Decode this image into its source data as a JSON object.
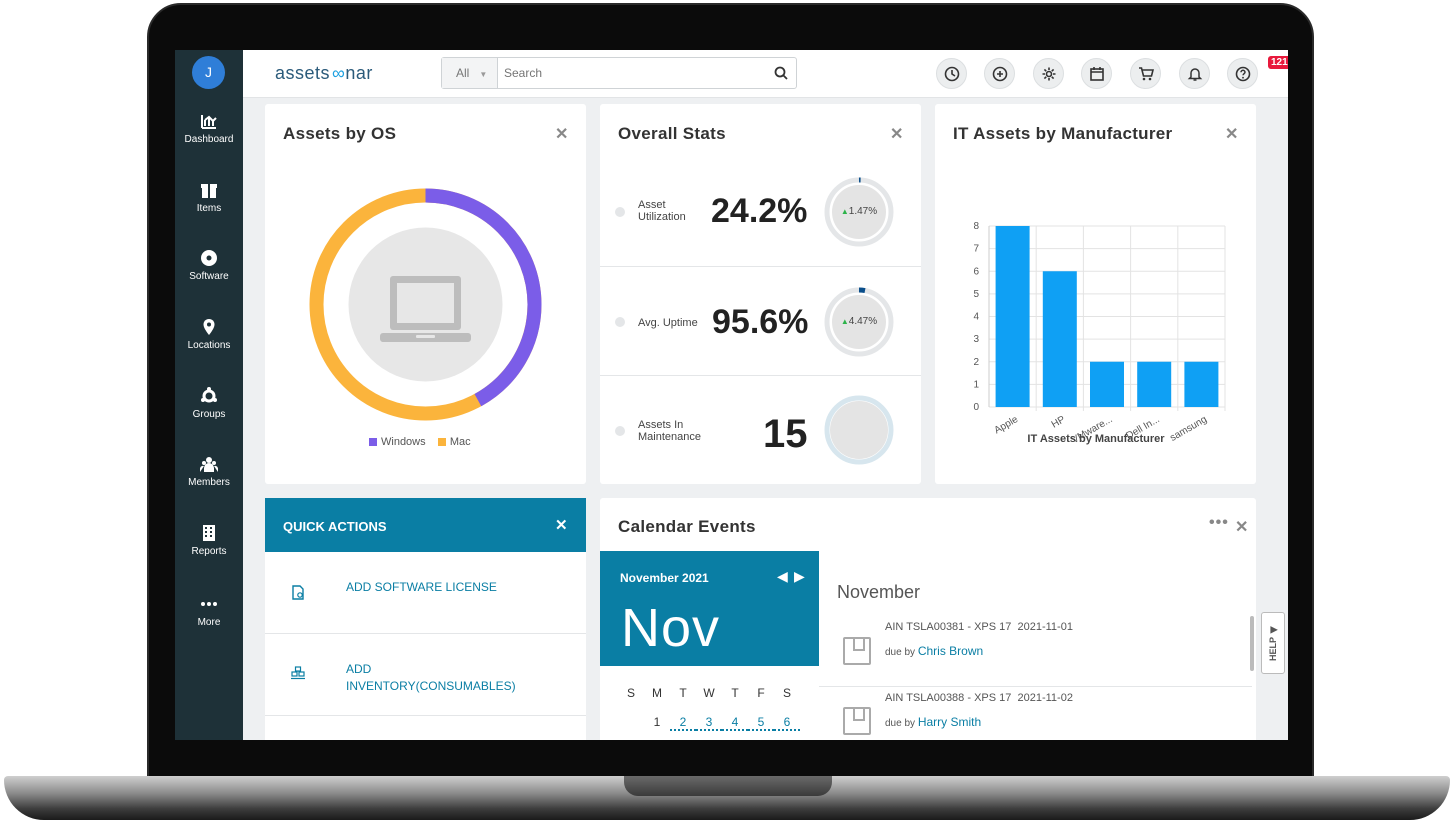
{
  "user": {
    "initial": "J"
  },
  "app": {
    "logo_a": "assets",
    "logo_o": "o",
    "logo_b": "nar"
  },
  "nav": [
    {
      "label": "Dashboard"
    },
    {
      "label": "Items"
    },
    {
      "label": "Software"
    },
    {
      "label": "Locations"
    },
    {
      "label": "Groups"
    },
    {
      "label": "Members"
    },
    {
      "label": "Reports"
    },
    {
      "label": "More"
    }
  ],
  "search": {
    "scope": "All",
    "placeholder": "Search"
  },
  "notifications": {
    "count": "121"
  },
  "os_card": {
    "title": "Assets by OS",
    "legend": [
      "Windows",
      "Mac"
    ],
    "colors": {
      "windows": "#7b5de8",
      "mac": "#fbb43c"
    },
    "windows_share": 0.42
  },
  "stats": {
    "title": "Overall Stats",
    "rows": [
      {
        "label1": "Asset",
        "label2": "Utilization",
        "value": "24.2%",
        "delta": "1.47%"
      },
      {
        "label1": "Avg. Uptime",
        "label2": "",
        "value": "95.6%",
        "delta": "4.47%"
      },
      {
        "label1": "Assets In",
        "label2": "Maintenance",
        "value": "15",
        "delta": ""
      }
    ]
  },
  "manufacturer": {
    "title": "IT Assets by Manufacturer"
  },
  "chart_data": {
    "type": "bar",
    "title": "",
    "categories": [
      "Apple",
      "HP",
      "VMware...",
      "Dell In...",
      "samsung"
    ],
    "values": [
      8,
      6,
      2,
      2,
      2
    ],
    "xlabel": "IT Assets by Manufacturer",
    "ylabel": "",
    "ylim": [
      0,
      8
    ],
    "yticks": [
      0,
      1,
      2,
      3,
      4,
      5,
      6,
      7,
      8
    ],
    "color": "#0fa0f4",
    "grid": true
  },
  "quick": {
    "title": "QUICK ACTIONS",
    "items": [
      {
        "label": "ADD SOFTWARE LICENSE"
      },
      {
        "label": "ADD",
        "label2": "INVENTORY(CONSUMABLES)"
      }
    ]
  },
  "calendar": {
    "title": "Calendar Events",
    "month_label": "November 2021",
    "month_short": "Nov",
    "weekdays": [
      "S",
      "M",
      "T",
      "W",
      "T",
      "F",
      "S"
    ],
    "dates": [
      "1",
      "2",
      "3",
      "4",
      "5",
      "6"
    ],
    "heading": "November",
    "events": [
      {
        "item": "AIN TSLA00381 - XPS 17",
        "date": "2021-11-01",
        "by": "due by",
        "person": "Chris Brown"
      },
      {
        "item": "AIN TSLA00388 - XPS 17",
        "date": "2021-11-02",
        "by": "due by",
        "person": "Harry Smith"
      }
    ]
  },
  "help": {
    "label": "HELP"
  }
}
